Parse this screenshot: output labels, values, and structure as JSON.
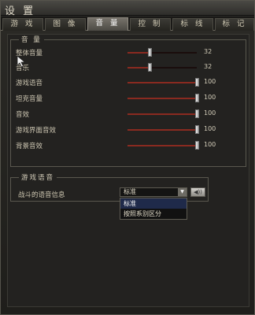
{
  "window": {
    "title": "设 置"
  },
  "tabs": [
    "游 戏",
    "图 像",
    "音 量",
    "控 制",
    "标 线",
    "标 记"
  ],
  "volume": {
    "title": "音 量",
    "items": [
      {
        "label": "整体音量",
        "value": 32,
        "fraction": 0.32
      },
      {
        "label": "音乐",
        "value": 32,
        "fraction": 0.32
      },
      {
        "label": "游戏语音",
        "value": 100,
        "fraction": 1.0
      },
      {
        "label": "坦克音量",
        "value": 100,
        "fraction": 1.0
      },
      {
        "label": "音效",
        "value": 100,
        "fraction": 1.0
      },
      {
        "label": "游戏界面音效",
        "value": 100,
        "fraction": 1.0
      },
      {
        "label": "背景音效",
        "value": 100,
        "fraction": 1.0
      }
    ]
  },
  "voice": {
    "title": "游戏语音",
    "label": "战斗的语音信息",
    "selected": "标准",
    "options": [
      "标准",
      "按照系别区分"
    ]
  },
  "colors": {
    "accent": "#8a2a20",
    "panel": "#232220",
    "selected_option": "#1f2a4a"
  },
  "icons": {
    "dropdown": "chevron-down-icon",
    "sound_test": "speaker-icon",
    "cursor": "mouse-pointer-icon"
  }
}
